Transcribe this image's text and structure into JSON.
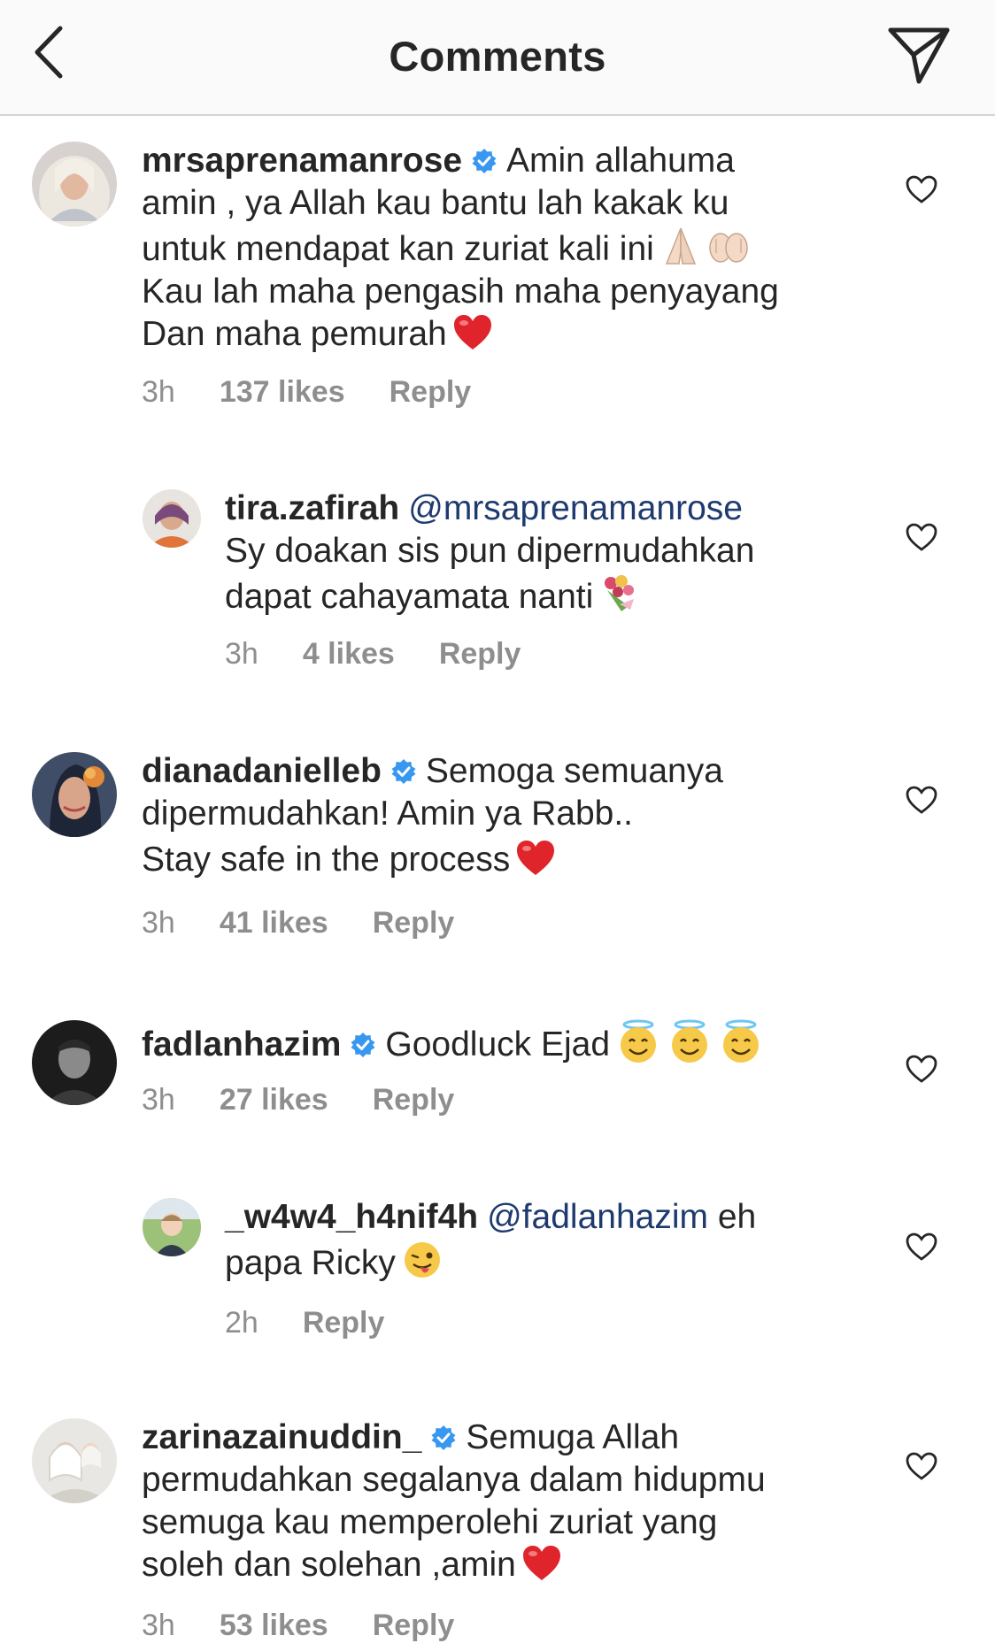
{
  "header": {
    "title": "Comments",
    "back_icon": "chevron-left-icon",
    "send_icon": "paper-plane-icon"
  },
  "colors": {
    "text": "#262626",
    "muted": "#8e8e8e",
    "verified": "#3897f0",
    "mention": "#1e3a6e",
    "header_bg": "#fafafa"
  },
  "comments": [
    {
      "username": "mrsaprenamanrose",
      "verified": true,
      "lines": [
        "Amin allahuma",
        "amin , ya Allah kau bantu lah kakak ku",
        "untuk mendapat kan zuriat kali ini",
        "Kau lah maha pengasih maha penyayang",
        "Dan maha pemurah"
      ],
      "time": "3h",
      "likes": "137 likes",
      "reply": "Reply"
    },
    {
      "username": "tira.zafirah",
      "mention": "@mrsaprenamanrose",
      "lines": [
        "Sy doakan sis pun dipermudahkan",
        "dapat cahayamata nanti"
      ],
      "time": "3h",
      "likes": "4 likes",
      "reply": "Reply"
    },
    {
      "username": "dianadanielleb",
      "verified": true,
      "lines": [
        "Semoga semuanya",
        "dipermudahkan! Amin ya Rabb..",
        "Stay safe in the process"
      ],
      "time": "3h",
      "likes": "41 likes",
      "reply": "Reply"
    },
    {
      "username": "fadlanhazim",
      "verified": true,
      "lines": [
        "Goodluck Ejad"
      ],
      "time": "3h",
      "likes": "27 likes",
      "reply": "Reply"
    },
    {
      "username": "_w4w4_h4nif4h",
      "mention": "@fadlanhazim",
      "lines": [
        "eh",
        "papa Ricky"
      ],
      "time": "2h",
      "reply": "Reply"
    },
    {
      "username": "zarinazainuddin_",
      "verified": true,
      "lines": [
        "Semuga Allah",
        "permudahkan segalanya dalam hidupmu",
        "semuga kau memperolehi zuriat yang",
        "soleh dan solehan ,amin"
      ],
      "time": "3h",
      "likes": "53 likes",
      "reply": "Reply"
    }
  ]
}
